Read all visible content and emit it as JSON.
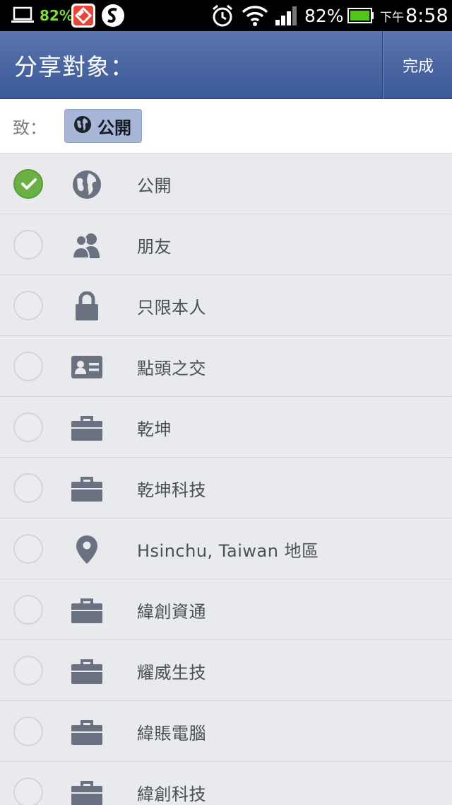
{
  "status_bar": {
    "left_battery_pct": "82%",
    "battery_pct": "82%",
    "time_prefix": "下午",
    "time": "8:58",
    "battery_color": "#7fd83a"
  },
  "header": {
    "title": "分享對象：",
    "done_label": "完成",
    "background": "#3b5998"
  },
  "to_row": {
    "label": "致：",
    "chip_label": "公開",
    "chip_icon": "globe-icon"
  },
  "audience_list": [
    {
      "label": "公開",
      "icon": "globe-icon",
      "selected": true
    },
    {
      "label": "朋友",
      "icon": "friends-icon",
      "selected": false
    },
    {
      "label": "只限本人",
      "icon": "lock-icon",
      "selected": false
    },
    {
      "label": "點頭之交",
      "icon": "id-card-icon",
      "selected": false
    },
    {
      "label": "乾坤",
      "icon": "briefcase-icon",
      "selected": false
    },
    {
      "label": "乾坤科技",
      "icon": "briefcase-icon",
      "selected": false
    },
    {
      "label": "Hsinchu, Taiwan 地區",
      "icon": "location-pin-icon",
      "selected": false
    },
    {
      "label": "緯創資通",
      "icon": "briefcase-icon",
      "selected": false
    },
    {
      "label": "耀威生技",
      "icon": "briefcase-icon",
      "selected": false
    },
    {
      "label": "緯賬電腦",
      "icon": "briefcase-icon",
      "selected": false
    },
    {
      "label": "緯創科技",
      "icon": "briefcase-icon",
      "selected": false
    }
  ],
  "colors": {
    "check_green": "#6ab043",
    "icon_gray": "#6a7180"
  }
}
